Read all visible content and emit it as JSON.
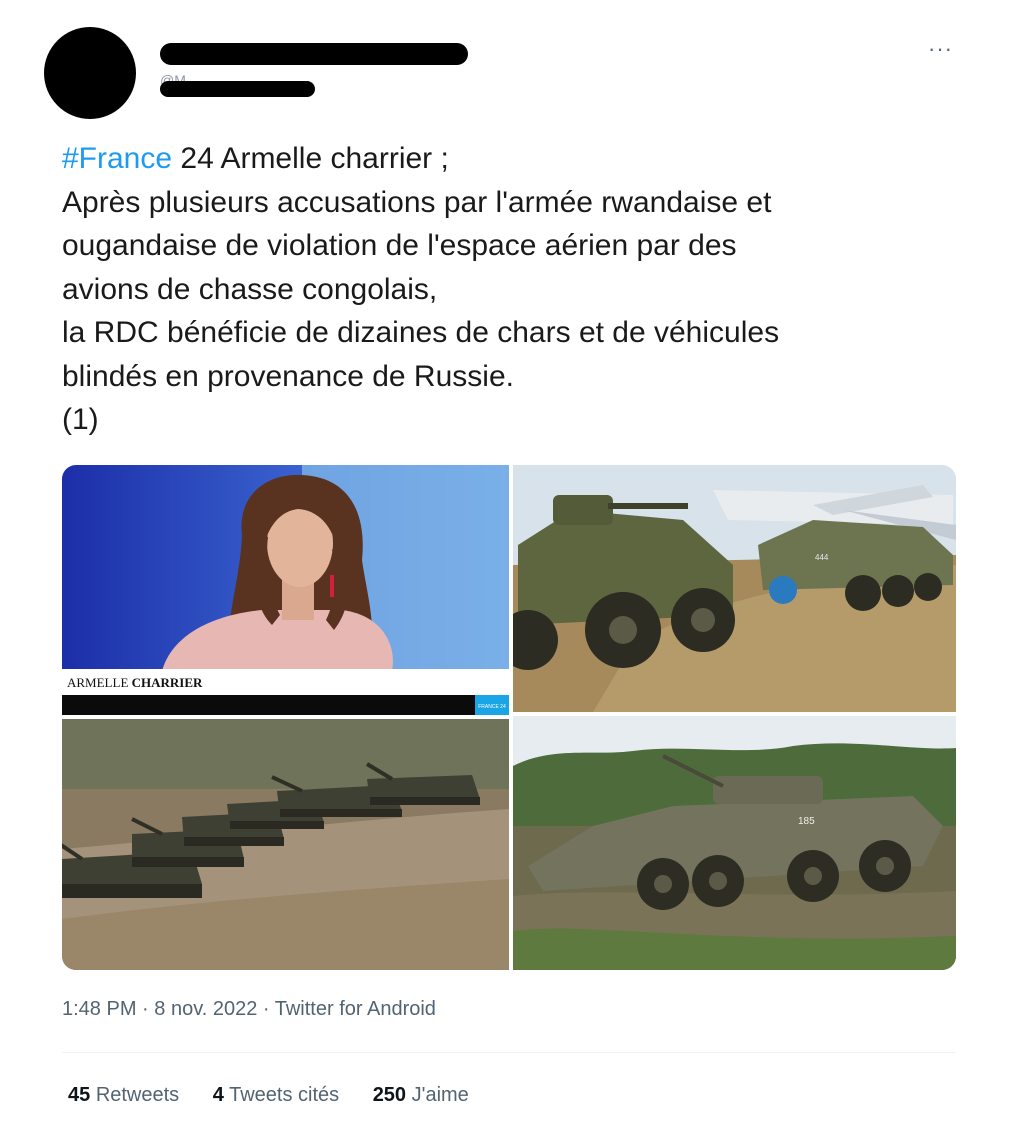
{
  "author": {
    "handle_fragment": "@M...",
    "redacted": true
  },
  "menu": {
    "more_label": "···"
  },
  "tweet": {
    "hashtag": "#France",
    "lines": [
      " 24 Armelle charrier ;",
      "Après plusieurs accusations par l'armée rwandaise et",
      "ougandaise de violation de l'espace aérien par des",
      "avions de chasse congolais,",
      "la RDC bénéficie de dizaines de chars et de véhicules",
      "blindés en provenance de Russie.",
      "(1)"
    ]
  },
  "media": {
    "tile1": {
      "lower_third_name_regular": "ARMELLE ",
      "lower_third_name_bold": "CHARRIER",
      "logo_text": "FRANCE 24"
    },
    "tile2": {
      "vehicle_number": "444"
    },
    "tile4": {
      "vehicle_number": "185"
    }
  },
  "meta": {
    "time": "1:48 PM",
    "date": "8 nov. 2022",
    "source": "Twitter for Android",
    "separator": " · "
  },
  "stats": {
    "retweets_count": "45",
    "retweets_label": "Retweets",
    "quotes_count": "4",
    "quotes_label": "Tweets cités",
    "likes_count": "250",
    "likes_label": "J'aime"
  },
  "colors": {
    "link": "#1d9bf0",
    "text": "#1a1a1a",
    "muted": "#536471"
  }
}
